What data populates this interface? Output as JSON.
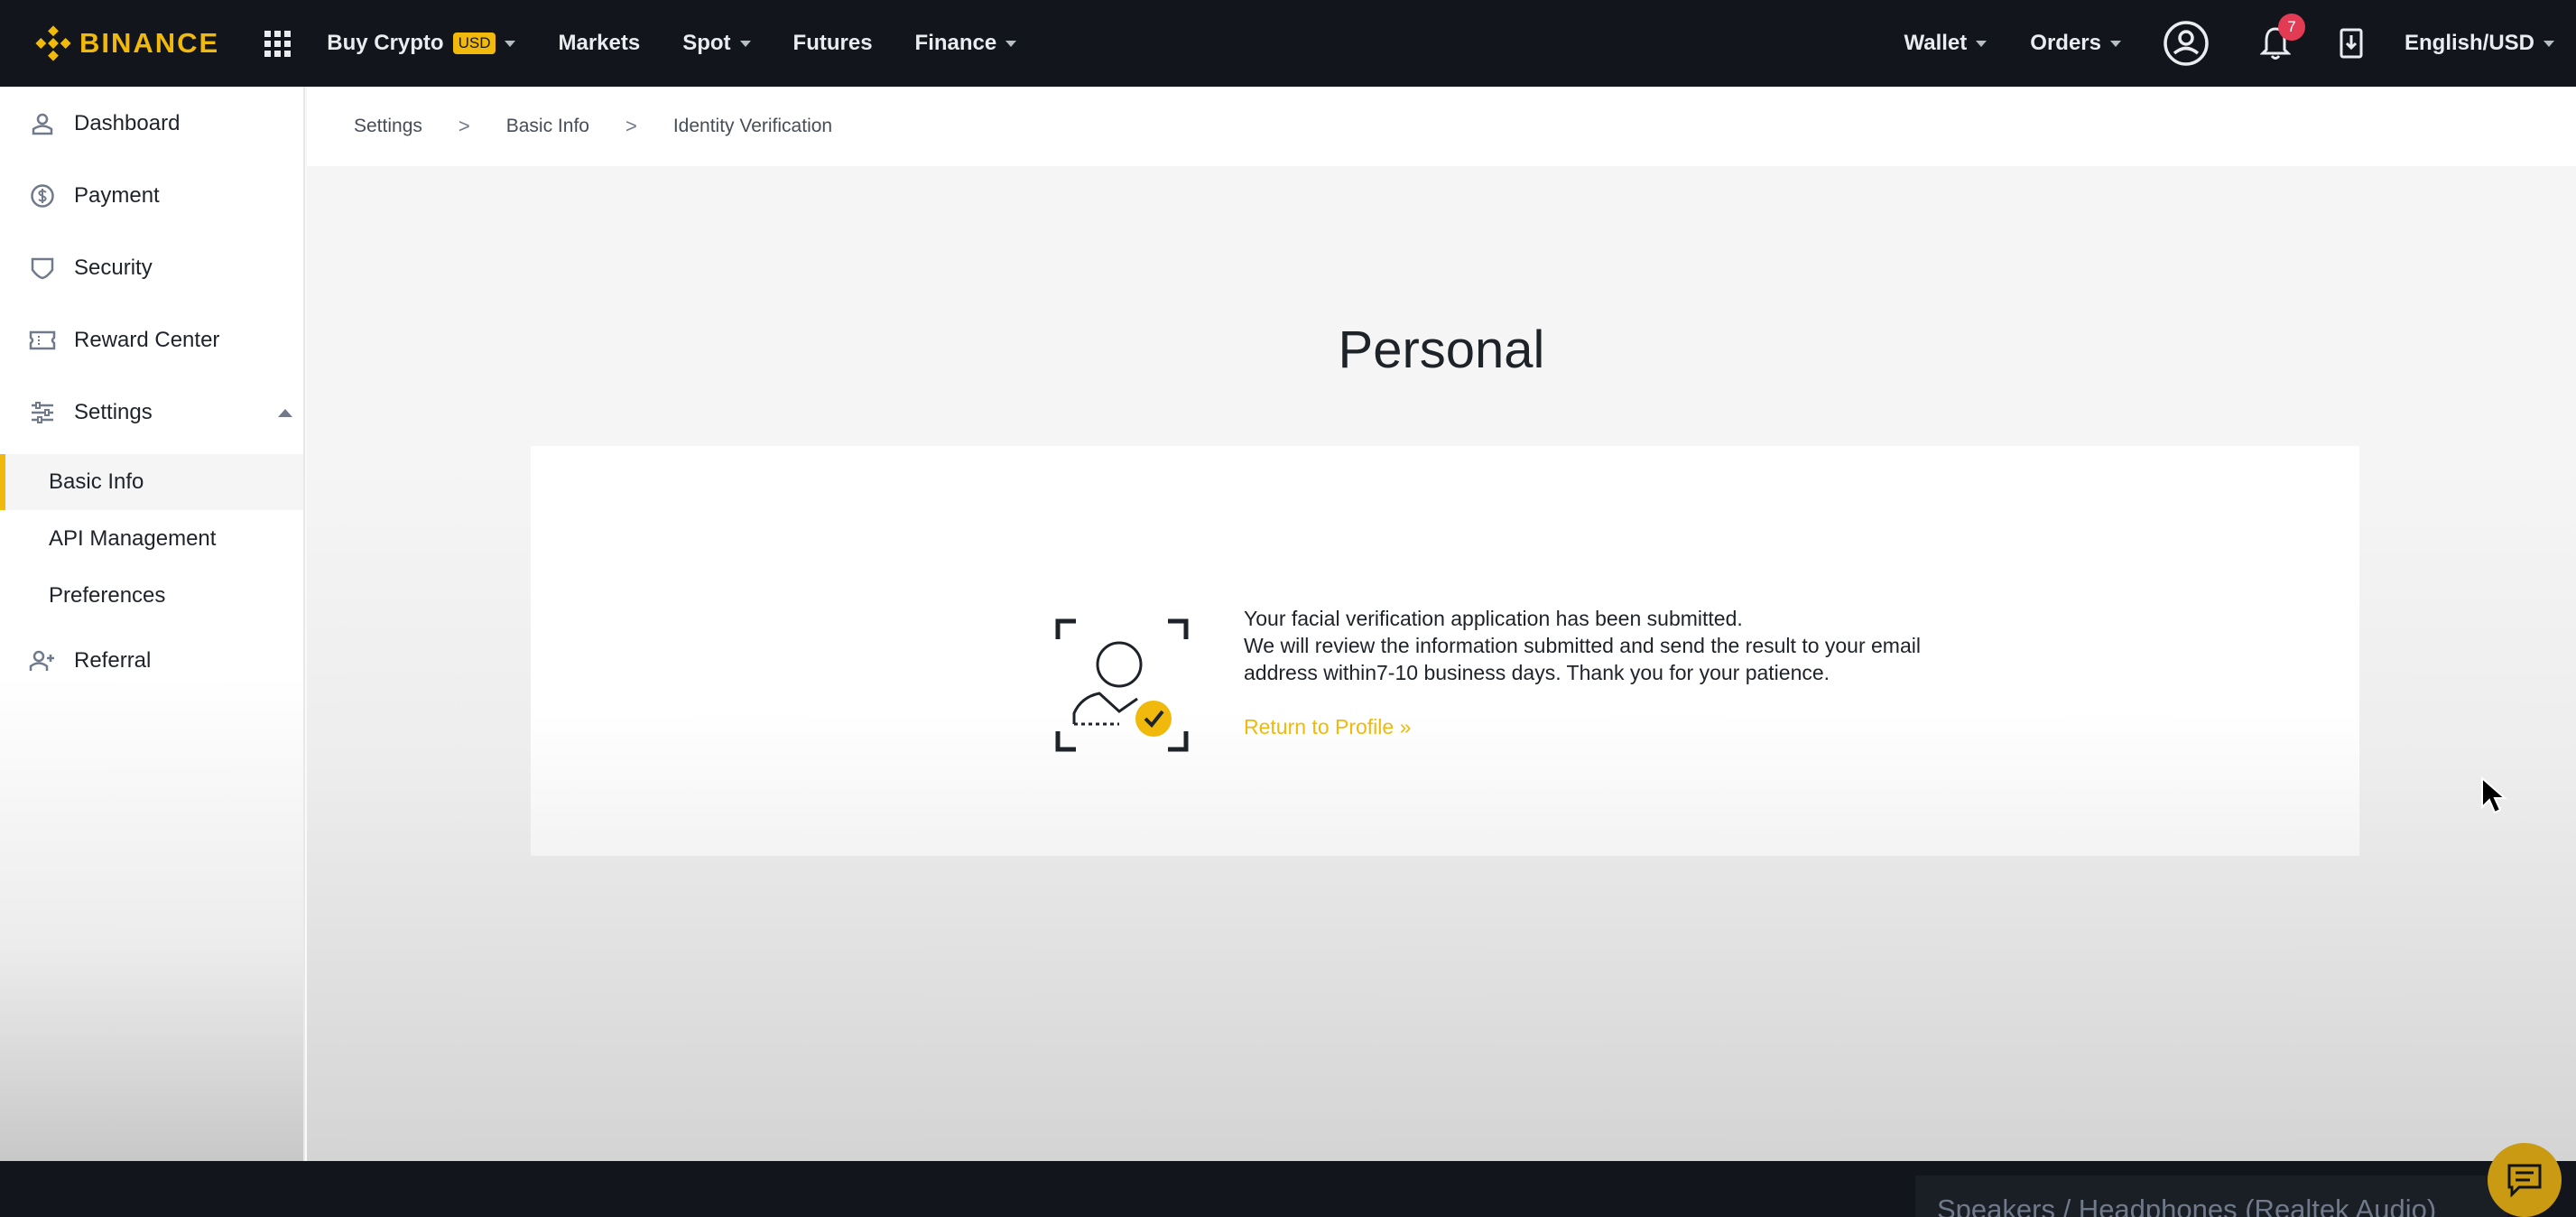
{
  "topbar": {
    "logo_text": "BINANCE",
    "nav": {
      "buy_crypto": "Buy Crypto",
      "buy_crypto_badge": "USD",
      "markets": "Markets",
      "spot": "Spot",
      "futures": "Futures",
      "finance": "Finance"
    },
    "right": {
      "wallet": "Wallet",
      "orders": "Orders",
      "notification_count": "7",
      "language_currency": "English/USD"
    }
  },
  "sidebar": {
    "items": [
      {
        "label": "Dashboard",
        "icon": "user-icon"
      },
      {
        "label": "Payment",
        "icon": "dollar-circle-icon"
      },
      {
        "label": "Security",
        "icon": "shield-icon"
      },
      {
        "label": "Reward Center",
        "icon": "ticket-icon"
      },
      {
        "label": "Settings",
        "icon": "sliders-icon",
        "expanded": true
      },
      {
        "label": "Referral",
        "icon": "user-add-icon"
      }
    ],
    "settings_sub": [
      {
        "label": "Basic Info",
        "active": true
      },
      {
        "label": "API Management",
        "active": false
      },
      {
        "label": "Preferences",
        "active": false
      }
    ]
  },
  "breadcrumb": {
    "items": [
      "Settings",
      "Basic Info",
      "Identity Verification"
    ],
    "separator": ">"
  },
  "main": {
    "title": "Personal",
    "message_line1": "Your facial verification application has been submitted.",
    "message_rest": "We will review the information submitted and send the result to your email address within7-10 business days. Thank you for your patience.",
    "return_link": "Return to Profile »"
  },
  "bottom": {
    "audio_device": "Speakers / Headphones (Realtek Audio)"
  },
  "colors": {
    "brand": "#f0b90b",
    "topbar_bg": "#12161c",
    "badge_red": "#e33b54"
  }
}
